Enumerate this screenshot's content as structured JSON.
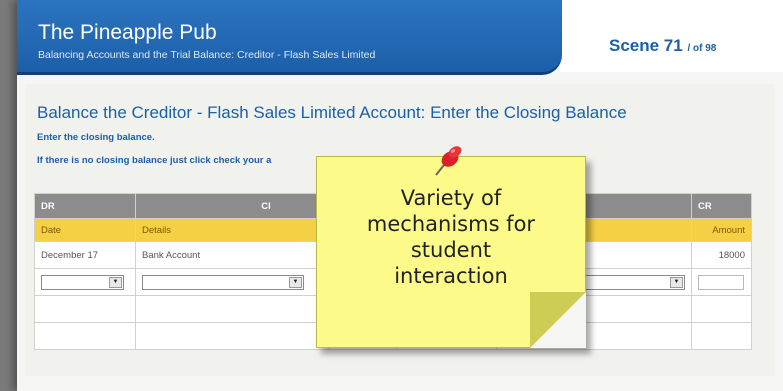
{
  "header": {
    "app_title": "The Pineapple Pub",
    "subtitle": "Balancing Accounts and the Trial Balance: Creditor - Flash Sales Limited",
    "scene_label": "Scene 71",
    "scene_total": "/ of 98"
  },
  "main": {
    "title": "Balance the Creditor - Flash Sales Limited Account: Enter the Closing Balance",
    "instruction1": "Enter the closing balance.",
    "instruction2": "If there is no closing balance just click check your a"
  },
  "table": {
    "headers": {
      "dr": "DR",
      "mid_left": "Cl",
      "cr": "CR"
    },
    "subheaders": {
      "date": "Date",
      "details": "Details",
      "amount": "Amount"
    },
    "row1": {
      "date": "December 17",
      "details": "Bank Account",
      "right_details": "ount",
      "amount": "18000"
    }
  },
  "note": {
    "text": "Variety of\nmechanisms  for\nstudent\ninteraction"
  },
  "colors": {
    "header_blue": "#1c5fa9",
    "table_header_gray": "#8c8c8c",
    "subheader_yellow": "#f6d044",
    "note_yellow": "#fcfb8a",
    "pin_red": "#e0242a"
  },
  "icons": {
    "pin": "push-pin-icon",
    "dropdown": "chevron-down-icon"
  }
}
